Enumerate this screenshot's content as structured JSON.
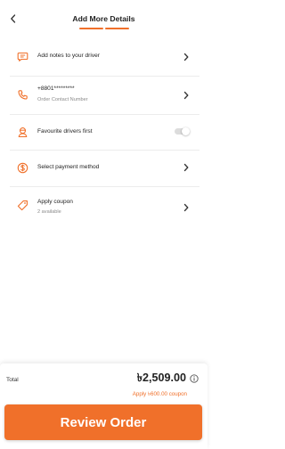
{
  "header": {
    "title": "Add More Details"
  },
  "options": {
    "notes": {
      "label": "Add notes to your driver",
      "icon": "message-icon"
    },
    "contact": {
      "label": "+8801*********",
      "sublabel": "Order Contact Number",
      "icon": "phone-icon"
    },
    "favourite": {
      "label": "Favourite drivers first",
      "icon": "driver-icon",
      "toggle_on": false
    },
    "payment": {
      "label": "Select payment method",
      "icon": "currency-icon"
    },
    "coupon": {
      "label": "Apply coupon",
      "sublabel": "2 available",
      "icon": "coupon-tag-icon"
    }
  },
  "footer": {
    "total_label": "Total",
    "total_amount": "৳2,509.00",
    "coupon_note": "Apply ৳600.00 coupon",
    "review_button": "Review Order"
  },
  "colors": {
    "accent": "#f0702a",
    "divider": "#ececec",
    "toggle_off": "#dcdcdc"
  }
}
